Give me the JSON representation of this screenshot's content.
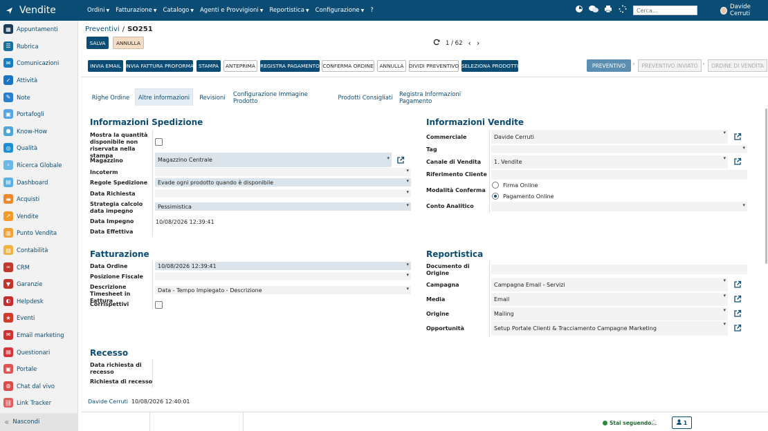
{
  "app": {
    "title": "Vendite"
  },
  "topmenu": [
    {
      "label": "Ordini"
    },
    {
      "label": "Fatturazione"
    },
    {
      "label": "Catalogo"
    },
    {
      "label": "Agenti e Provvigioni"
    },
    {
      "label": "Reportistica"
    },
    {
      "label": "Configurazione"
    }
  ],
  "topmenu_help": "?",
  "search": {
    "placeholder": "Cerca..."
  },
  "user": {
    "name": "Davide Cerruti"
  },
  "sidebar": {
    "items": [
      {
        "label": "Appuntamenti",
        "icon": "calendar-icon",
        "color": "#1c3d5a"
      },
      {
        "label": "Rubrica",
        "icon": "contacts-icon",
        "color": "#1a6f9c"
      },
      {
        "label": "Comunicazioni",
        "icon": "chat-icon",
        "color": "#1a7fc1"
      },
      {
        "label": "Attività",
        "icon": "check-icon",
        "color": "#1a73c4"
      },
      {
        "label": "Note",
        "icon": "note-icon",
        "color": "#2a7fd1"
      },
      {
        "label": "Portafogli",
        "icon": "wallet-icon",
        "color": "#58a6e8"
      },
      {
        "label": "Know-How",
        "icon": "knowledge-icon",
        "color": "#4ea7d8"
      },
      {
        "label": "Qualità",
        "icon": "quality-icon",
        "color": "#1e8ed6"
      },
      {
        "label": "Ricerca Globale",
        "icon": "search-icon",
        "color": "#69b8e6"
      },
      {
        "label": "Dashboard",
        "icon": "dashboard-icon",
        "color": "#58b2e6"
      },
      {
        "label": "Acquisti",
        "icon": "purchase-icon",
        "color": "#ee8a2e"
      },
      {
        "label": "Vendite",
        "icon": "sales-icon",
        "color": "#f39a2b"
      },
      {
        "label": "Punto Vendita",
        "icon": "pos-icon",
        "color": "#f1a23a"
      },
      {
        "label": "Contabilità",
        "icon": "accounting-icon",
        "color": "#f2b23e"
      },
      {
        "label": "CRM",
        "icon": "handshake-icon",
        "color": "#c2362c"
      },
      {
        "label": "Garanzie",
        "icon": "warranty-icon",
        "color": "#c3342a"
      },
      {
        "label": "Helpdesk",
        "icon": "headset-icon",
        "color": "#c32d2d"
      },
      {
        "label": "Eventi",
        "icon": "event-icon",
        "color": "#d23a2a"
      },
      {
        "label": "Email marketing",
        "icon": "email-icon",
        "color": "#cf3030"
      },
      {
        "label": "Questionari",
        "icon": "survey-icon",
        "color": "#d8343a"
      },
      {
        "label": "Portale",
        "icon": "portal-icon",
        "color": "#e25454"
      },
      {
        "label": "Chat dal vivo",
        "icon": "livechat-icon",
        "color": "#df4a4a"
      },
      {
        "label": "Link Tracker",
        "icon": "link-icon",
        "color": "#e06060"
      }
    ]
  },
  "collapse": {
    "label": "Nascondi"
  },
  "breadcrumb": {
    "parent": "Preventivi",
    "separator": "/",
    "current": "SO251"
  },
  "actions": {
    "save": "SALVA",
    "discard": "ANNULLA"
  },
  "pager": {
    "text": "1 / 62"
  },
  "buttons": [
    "INVIA EMAIL",
    "INVIA FATTURA PROFORMA",
    "STAMPA",
    "ANTEPRIMA",
    "REGISTRA PAGAMENTO",
    "CONFERMA ORDINE",
    "ANNULLA",
    "DIVIDI PREVENTIVO",
    "SELEZIONA PRODOTTI"
  ],
  "stages": [
    "PREVENTIVO",
    "PREVENTIVO INVIATO",
    "ORDINE DI VENDITA"
  ],
  "tabs": [
    "Righe Ordine",
    "Altre informazioni",
    "Revisioni",
    "Configurazione Immagine Prodotto",
    "Prodotti Consigliati",
    "Registra Informazioni Pagamento"
  ],
  "spedizione": {
    "title": "Informazioni Spedizione",
    "show_qty_label": "Mostra la quantità disponibile non riservata nella stampa",
    "warehouse_label": "Magazzino",
    "warehouse": "Magazzino Centrale",
    "incoterm_label": "Incoterm",
    "rules_label": "Regole Spedizione",
    "rules": "Evade ogni prodotto quando è disponibile",
    "requested_label": "Data Richiesta",
    "strategy_label": "Strategia calcolo data impegno",
    "strategy": "Pessimistica",
    "commitment_label": "Data Impegno",
    "commitment": "10/08/2026 12:39:41",
    "effective_label": "Data Effettiva"
  },
  "vendite": {
    "title": "Informazioni Vendite",
    "salesperson_label": "Commerciale",
    "salesperson": "Davide Cerruti",
    "tag_label": "Tag",
    "channel_label": "Canale di Vendita",
    "channel": "1. Vendite",
    "ref_label": "Riferimento Cliente",
    "confirm_label": "Modalità Conferma",
    "confirm_opt1": "Firma Online",
    "confirm_opt2": "Pagamento Online",
    "analytic_label": "Conto Analitico"
  },
  "fatturazione": {
    "title": "Fatturazione",
    "order_date_label": "Data Ordine",
    "order_date": "10/08/2026 12:39:41",
    "fiscal_label": "Posizione Fiscale",
    "timesheet_label": "Descrizione Timesheet in Fattura",
    "timesheet": "Data - Tempo Impiegato - Descrizione",
    "corrispettivi_label": "Corrispettivi"
  },
  "reportistica": {
    "title": "Reportistica",
    "origin_doc_label": "Documento di Origine",
    "campaign_label": "Campagna",
    "campaign": "Campagna Email - Servizi",
    "media_label": "Media",
    "media": "Email",
    "source_label": "Origine",
    "source": "Mailing",
    "opportunity_label": "Opportunità",
    "opportunity": "Setup Portale Clienti & Tracciamento Campagne Marketing"
  },
  "recesso": {
    "title": "Recesso",
    "request_date_label": "Data richiesta di recesso",
    "request_label": "Richiesta di recesso"
  },
  "footer": {
    "author": "Davide Cerruti",
    "date": "10/08/2026 12:40:01"
  },
  "chatter": {
    "following": "Stai seguendo",
    "followers": "1"
  }
}
